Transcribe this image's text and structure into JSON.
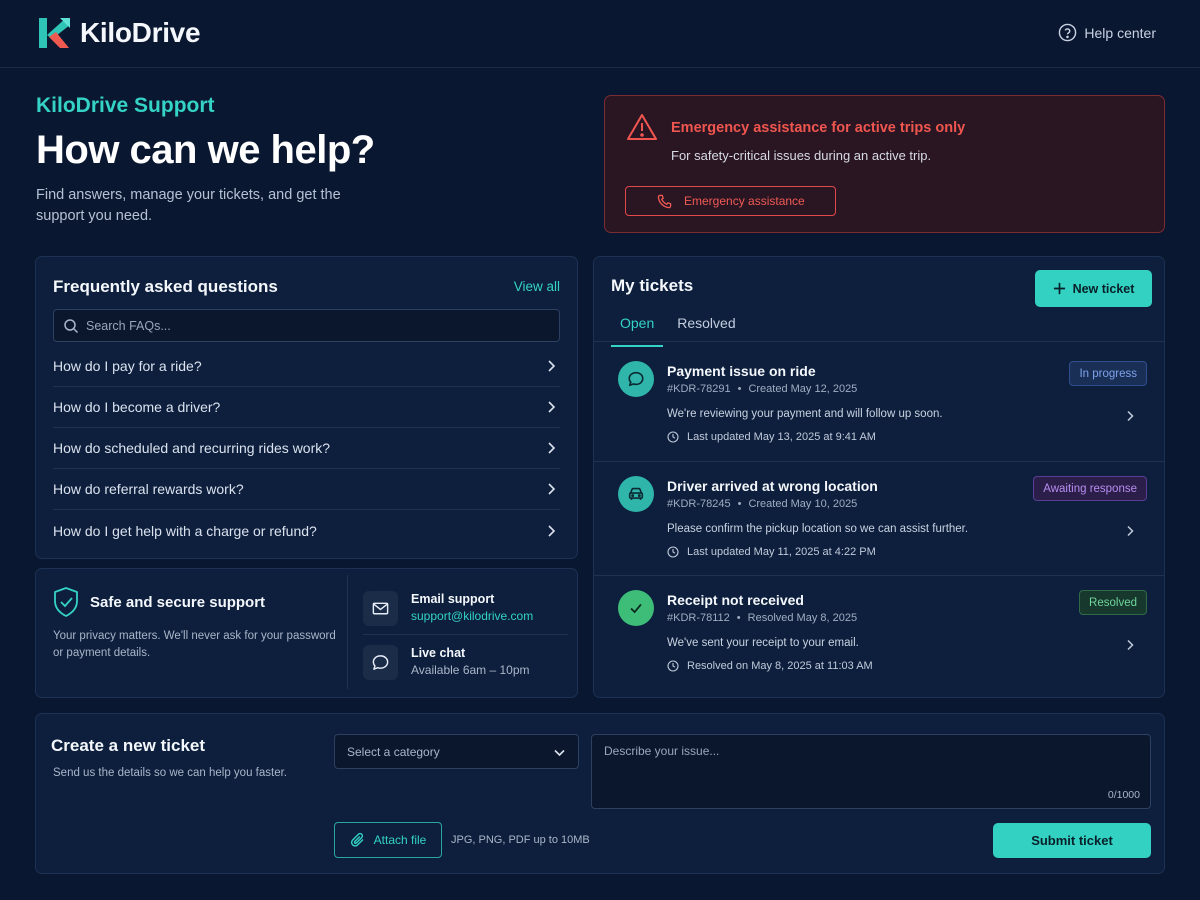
{
  "header": {
    "brand": "KiloDrive",
    "help_label": "Help center"
  },
  "hero": {
    "eyebrow": "KiloDrive Support",
    "title": "How can we help?",
    "subtitle": "Find answers, manage your tickets, and get the support you need."
  },
  "emergency": {
    "title": "Emergency assistance for active trips only",
    "subtitle": "For safety-critical issues during an active trip.",
    "button_label": "Emergency assistance",
    "color": "#f0564f"
  },
  "faq": {
    "title": "Frequently asked questions",
    "view_all": "View all",
    "search_placeholder": "Search FAQs...",
    "items": [
      {
        "label": "How do I pay for a ride?"
      },
      {
        "label": "How do I become a driver?"
      },
      {
        "label": "How do scheduled and recurring rides work?"
      },
      {
        "label": "How do referral rewards work?"
      },
      {
        "label": "How do I get help with a charge or refund?"
      }
    ]
  },
  "secure": {
    "title": "Safe and secure support",
    "text": "Your privacy matters. We'll never ask for your password or payment details.",
    "email_label": "Email support",
    "email_value": "support@kilodrive.com",
    "chat_label": "Live chat",
    "chat_value": "Available 6am – 10pm"
  },
  "tickets": {
    "title": "My tickets",
    "new_button": "New ticket",
    "tabs": [
      {
        "label": "Open",
        "active": true
      },
      {
        "label": "Resolved",
        "active": false
      }
    ],
    "items": [
      {
        "icon": "chat-bubble-icon",
        "title": "Payment issue on ride",
        "id": "#KDR-78291",
        "date": "Created May 12, 2025",
        "description": "We're reviewing your payment and will follow up soon.",
        "updated": "Last updated May 13, 2025 at 9:41 AM",
        "status": "In progress"
      },
      {
        "icon": "car-icon",
        "title": "Driver arrived at wrong location",
        "id": "#KDR-78245",
        "date": "Created May 10, 2025",
        "description": "Please confirm the pickup location so we can assist further.",
        "updated": "Last updated May 11, 2025 at 4:22 PM",
        "status": "Awaiting response"
      },
      {
        "icon": "check-icon",
        "title": "Receipt not received",
        "id": "#KDR-78112",
        "date": "Resolved May 8, 2025",
        "description": "We've sent your receipt to your email.",
        "updated": "Resolved on May 8, 2025 at 11:03 AM",
        "status": "Resolved"
      }
    ]
  },
  "create": {
    "title": "Create a new ticket",
    "subtitle": "Send us the details so we can help you faster.",
    "category_placeholder": "Select a category",
    "description_placeholder": "Describe your issue...",
    "counter": "0/1000",
    "attach_label": "Attach file",
    "file_hint": "JPG, PNG, PDF up to 10MB",
    "submit_label": "Submit ticket"
  },
  "colors": {
    "background": "#0a1730",
    "accent": "#33d1c1",
    "danger": "#f0564f"
  }
}
